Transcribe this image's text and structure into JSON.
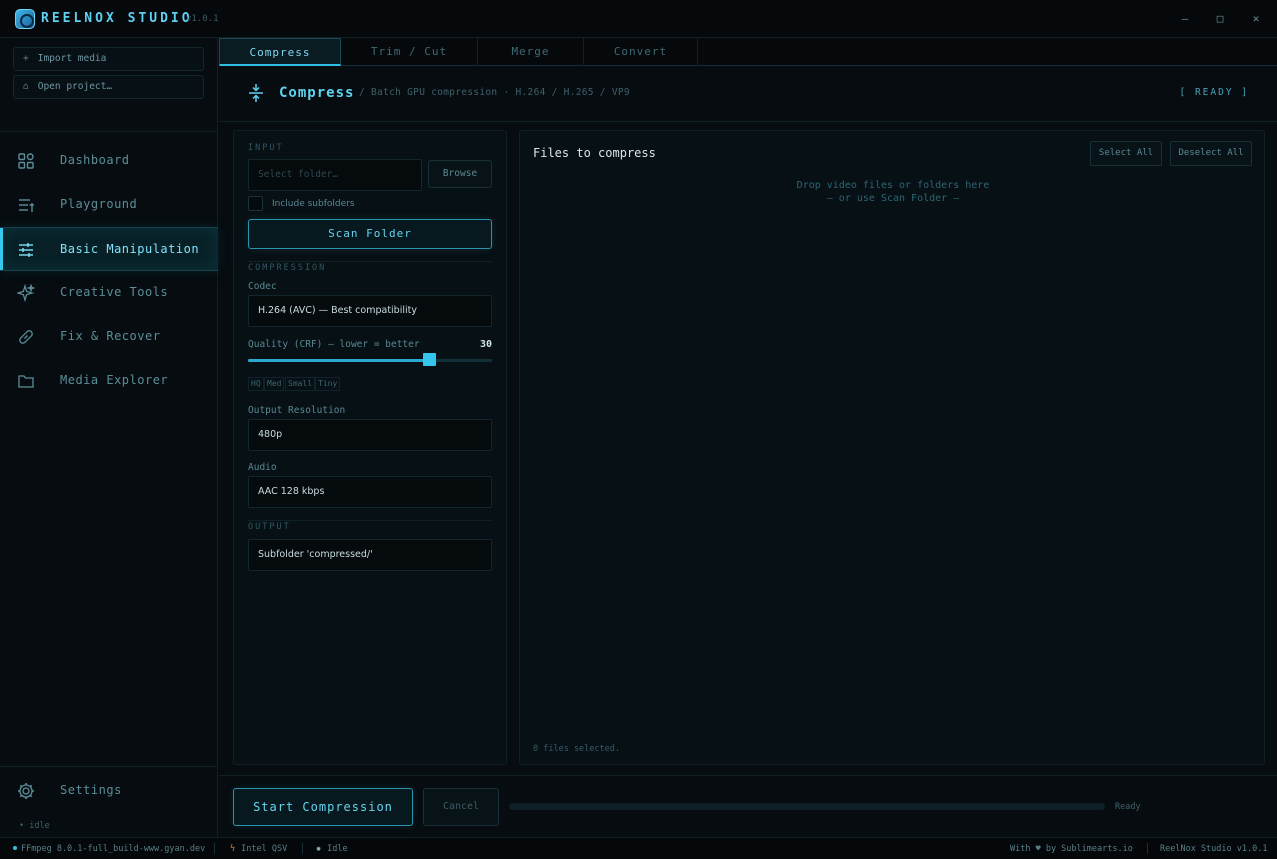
{
  "app": {
    "name": "REELNOX STUDIO",
    "version": "v1.0.1"
  },
  "window": {
    "minimize": "—",
    "maximize": "□",
    "close": "✕"
  },
  "sidebar": {
    "actions": [
      {
        "icon": "+",
        "label": "Import media"
      },
      {
        "icon": "⌂",
        "label": "Open project…"
      }
    ],
    "items": [
      {
        "label": "Dashboard",
        "icon": "grid-icon"
      },
      {
        "label": "Playground",
        "icon": "list-icon"
      },
      {
        "label": "Basic Manipulation",
        "icon": "sliders-icon",
        "active": true
      },
      {
        "label": "Creative Tools",
        "icon": "sparkle-icon"
      },
      {
        "label": "Fix & Recover",
        "icon": "bandage-icon"
      },
      {
        "label": "Media Explorer",
        "icon": "folder-icon"
      }
    ],
    "settings": "Settings",
    "idle": "• idle"
  },
  "tabs": [
    {
      "label": "Compress",
      "active": true
    },
    {
      "label": "Trim / Cut"
    },
    {
      "label": "Merge"
    },
    {
      "label": "Convert"
    }
  ],
  "header": {
    "title": "Compress",
    "subtitle": "/ Batch GPU compression · H.264 / H.265 / VP9",
    "status": "[ READY ]"
  },
  "input_section": {
    "label": "INPUT",
    "folder_placeholder": "Select folder…",
    "browse": "Browse",
    "include_subfolders": "Include subfolders",
    "scan": "Scan Folder"
  },
  "compression": {
    "label": "COMPRESSION",
    "codec_label": "Codec",
    "codec_value": "H.264 (AVC)  — Best compatibility",
    "quality_label": "Quality (CRF)  —  lower = better",
    "quality_value": "30",
    "quality_fraction": 0.74,
    "presets": [
      "HQ",
      "Med",
      "Small",
      "Tiny"
    ],
    "resolution_label": "Output Resolution",
    "resolution_value": "480p",
    "audio_label": "Audio",
    "audio_value": "AAC 128 kbps"
  },
  "output": {
    "label": "OUTPUT",
    "value": "Subfolder 'compressed/'"
  },
  "files": {
    "title": "Files to compress",
    "select_all": "Select All",
    "deselect_all": "Deselect All",
    "drop_line1": "Drop video files or folders here",
    "drop_line2": "—  or use Scan Folder  —",
    "count": "0 files selected."
  },
  "actions": {
    "start": "Start Compression",
    "cancel": "Cancel",
    "progress": 0,
    "progress_status": "Ready"
  },
  "statusbar": {
    "ffmpeg": "FFmpeg 8.0.1-full_build-www.gyan.dev",
    "gpu": "Intel QSV",
    "state": "Idle",
    "credit": "With ♥ by Sublimearts.io",
    "version": "ReelNox Studio v1.0.1"
  },
  "colors": {
    "accent": "#35c9ee",
    "background": "#060c0f",
    "panel": "#071014"
  }
}
